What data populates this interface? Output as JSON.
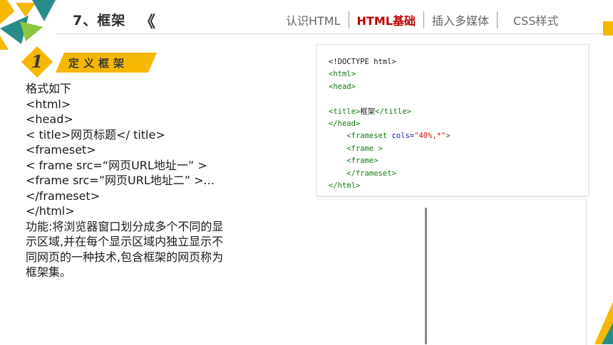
{
  "header": {
    "title": "7、框架",
    "chevron": "《",
    "nav": [
      "认识HTML",
      "HTML基础",
      "插入多媒体",
      "CSS样式"
    ],
    "active_index": 1
  },
  "section": {
    "number": "1",
    "tag": "定义框架"
  },
  "body": {
    "lines": [
      "格式如下",
      "<html>",
      "<head>",
      "< title>网页标题</ title>",
      "<frameset>",
      "< frame src=“网页URL地址一” >",
      "<frame src=”网页URL地址二” >...",
      "</frameset>",
      "</html>"
    ],
    "description": "功能:将浏览器窗口划分成多个不同的显示区域,并在每个显示区域内独立显示不同网页的一种技术,包含框架的网页称为框架集。"
  },
  "code_sample": {
    "doctype": "<!DOCTYPE html>",
    "html_open": "<html>",
    "head_open": "<head>",
    "title_open": "<title>",
    "title_text": "框架",
    "title_close": "</title>",
    "head_close": "</head>",
    "frameset_open": "<frameset ",
    "frameset_attr": "cols=",
    "frameset_value": "\"40%,*\"",
    "frameset_end": ">",
    "frame1": "<frame >",
    "frame2": "<frame>",
    "frameset_close": "</frameset>",
    "html_close": "</html>"
  },
  "colors": {
    "accent_red": "#c00000",
    "deco_teal": "#2a8c8a",
    "deco_yellow": "#f5b700",
    "deco_green": "#8cc63f"
  }
}
